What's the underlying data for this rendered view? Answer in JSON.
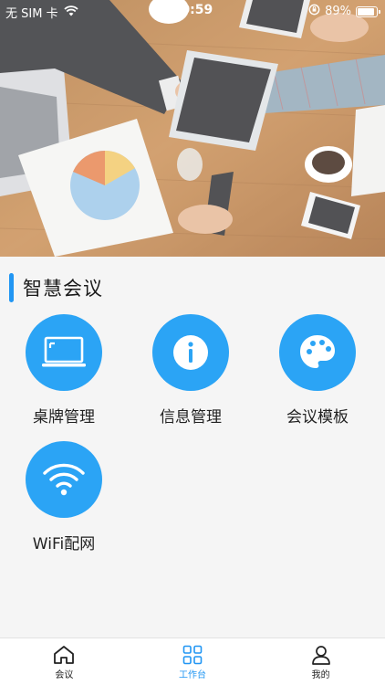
{
  "status_bar": {
    "carrier": "无 SIM 卡",
    "time": "10:59",
    "battery_percent": "89%",
    "battery_level": 0.89
  },
  "section": {
    "title": "智慧会议"
  },
  "functions": [
    {
      "label": "桌牌管理",
      "icon": "laptop-icon"
    },
    {
      "label": "信息管理",
      "icon": "info-icon"
    },
    {
      "label": "会议模板",
      "icon": "palette-icon"
    },
    {
      "label": "WiFi配网",
      "icon": "wifi-icon"
    }
  ],
  "tab_bar": {
    "tabs": [
      {
        "label": "会议",
        "icon": "home-icon",
        "active": false
      },
      {
        "label": "工作台",
        "icon": "grid-icon",
        "active": true
      },
      {
        "label": "我的",
        "icon": "user-icon",
        "active": false
      }
    ]
  },
  "colors": {
    "accent": "#2196f3",
    "icon_circle": "#2ba4f5",
    "background": "#f5f5f5"
  }
}
